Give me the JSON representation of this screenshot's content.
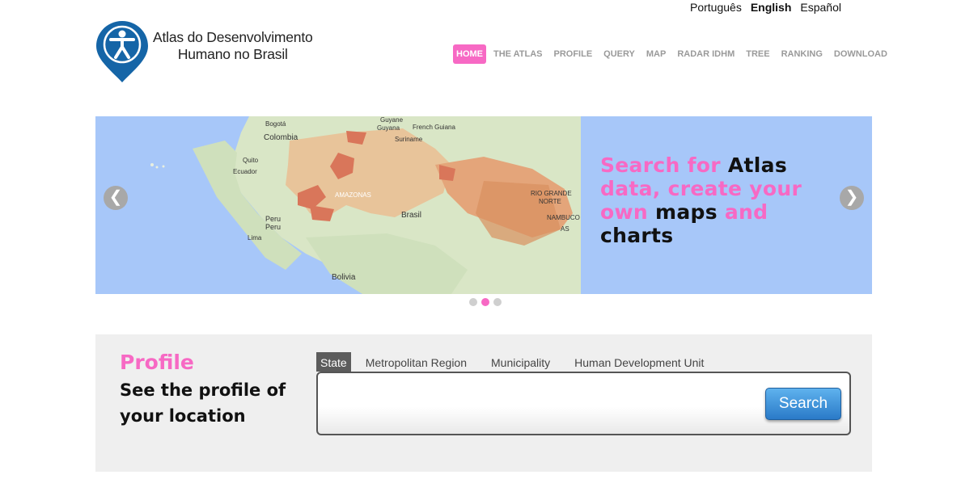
{
  "languages": [
    {
      "label": "Português",
      "active": false
    },
    {
      "label": "English",
      "active": true
    },
    {
      "label": "Español",
      "active": false
    }
  ],
  "logo": {
    "line1": "Atlas do Desenvolvimento",
    "line2": "Humano no Brasil"
  },
  "nav": [
    "HOME",
    "THE ATLAS",
    "PROFILE",
    "QUERY",
    "MAP",
    "RADAR IDHM",
    "TREE",
    "RANKING",
    "DOWNLOAD"
  ],
  "hero": {
    "map_labels": [
      "Bogotá",
      "Colombia",
      "Quito",
      "Ecuador",
      "Peru",
      "Lima",
      "Bolivia",
      "Guyane",
      "Guyana",
      "French Guiana",
      "Suriname",
      "Brasil",
      "AMAZONAS",
      "RIO GRANDE",
      "NORTE",
      "NAMBUCO",
      "AS"
    ],
    "headline": [
      {
        "text": "Search for ",
        "color": "pink"
      },
      {
        "text": "Atlas",
        "color": "black"
      },
      {
        "text": "data, create your",
        "color": "pink"
      },
      {
        "text": "own ",
        "color": "pink"
      },
      {
        "text": "maps ",
        "color": "black"
      },
      {
        "text": "and",
        "color": "pink"
      },
      {
        "text": "charts",
        "color": "black"
      }
    ],
    "prev_icon": "❮",
    "next_icon": "❯",
    "slide_count": 3,
    "active_slide": 2
  },
  "profile": {
    "title": "Profile",
    "subtitle": "See the profile of your location",
    "tabs": [
      "State",
      "Metropolitan Region",
      "Municipality",
      "Human Development Unit"
    ],
    "active_tab": 0,
    "search_value": "",
    "search_button": "Search"
  },
  "colors": {
    "accent_pink": "#f769c4",
    "map_water": "#a7c7f9",
    "button_blue": "#3b8fd9"
  }
}
